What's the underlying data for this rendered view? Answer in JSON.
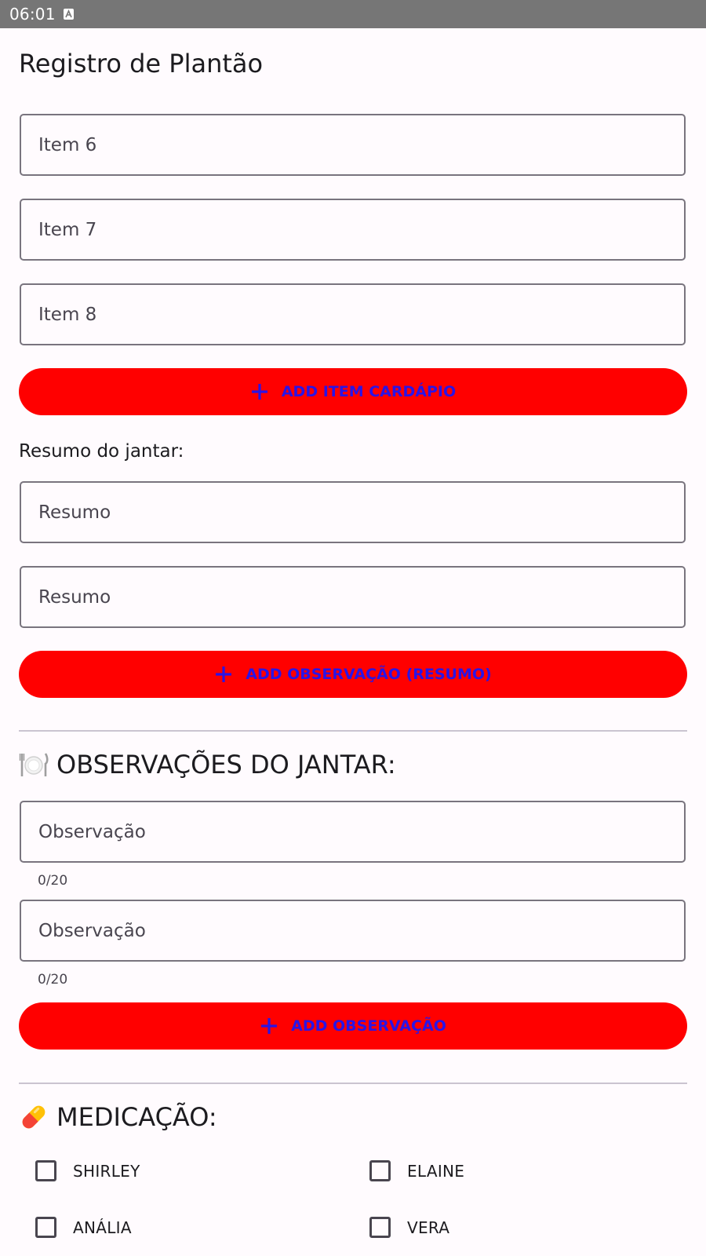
{
  "status_bar": {
    "time": "06:01"
  },
  "page": {
    "title": "Registro de Plantão"
  },
  "menu_items": [
    {
      "placeholder": "Item 6"
    },
    {
      "placeholder": "Item 7"
    },
    {
      "placeholder": "Item 8"
    }
  ],
  "add_menu_item_button": {
    "label": "ADD ITEM CARDÁPIO"
  },
  "dinner_summary": {
    "label": "Resumo do jantar:",
    "fields": [
      {
        "placeholder": "Resumo"
      },
      {
        "placeholder": "Resumo"
      }
    ],
    "add_button_label": "ADD OBSERVAÇÃO (RESUMO)"
  },
  "dinner_observations": {
    "heading": "OBSERVAÇÕES DO JANTAR:",
    "icon": "plate-cutlery-icon",
    "fields": [
      {
        "placeholder": "Observação",
        "counter": "0/20"
      },
      {
        "placeholder": "Observação",
        "counter": "0/20"
      }
    ],
    "add_button_label": "ADD OBSERVAÇÃO"
  },
  "medication": {
    "heading": "MEDICAÇÃO:",
    "icon": "pill-icon",
    "patients": [
      {
        "name": "SHIRLEY",
        "checked": false
      },
      {
        "name": "ELAINE",
        "checked": false
      },
      {
        "name": "ANÁLIA",
        "checked": false
      },
      {
        "name": "VERA",
        "checked": false
      }
    ]
  },
  "colors": {
    "button_background": "#ff0000",
    "button_text": "#2a14e6",
    "status_bar": "#767676",
    "outline": "#79747e"
  }
}
